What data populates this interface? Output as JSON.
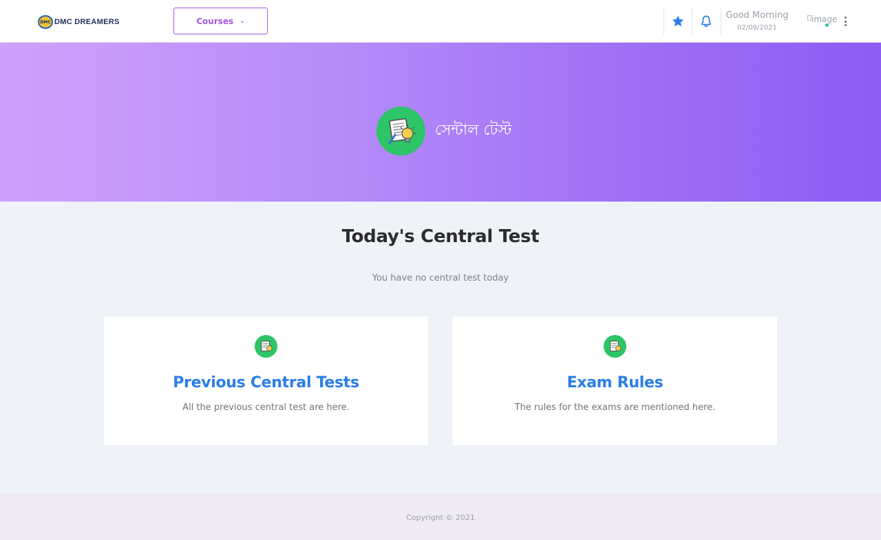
{
  "header": {
    "logo_badge": "DMC",
    "logo_text": "DMC DREAMERS",
    "courses_label": "Courses",
    "greeting": "Good Morning",
    "date": "02/09/2021",
    "avatar_alt": "image"
  },
  "hero": {
    "title": "সেন্টাল টেস্ট"
  },
  "main": {
    "title": "Today's Central Test",
    "empty_message": "You have no central test today"
  },
  "cards": [
    {
      "title": "Previous Central Tests",
      "description": "All the previous central test are here."
    },
    {
      "title": "Exam Rules",
      "description": "The rules for the exams are mentioned here."
    }
  ],
  "footer": {
    "copyright": "Copyright © 2021"
  },
  "colors": {
    "accent_purple": "#a259e8",
    "link_blue": "#2a7de8",
    "icon_green": "#2ec468",
    "hero_start": "#d0a1fb",
    "hero_end": "#8d5cf2"
  },
  "icons": {
    "favorite": "star-icon",
    "notifications": "bell-icon",
    "menu": "kebab-menu-icon",
    "test": "test-paper-bulb-icon"
  }
}
